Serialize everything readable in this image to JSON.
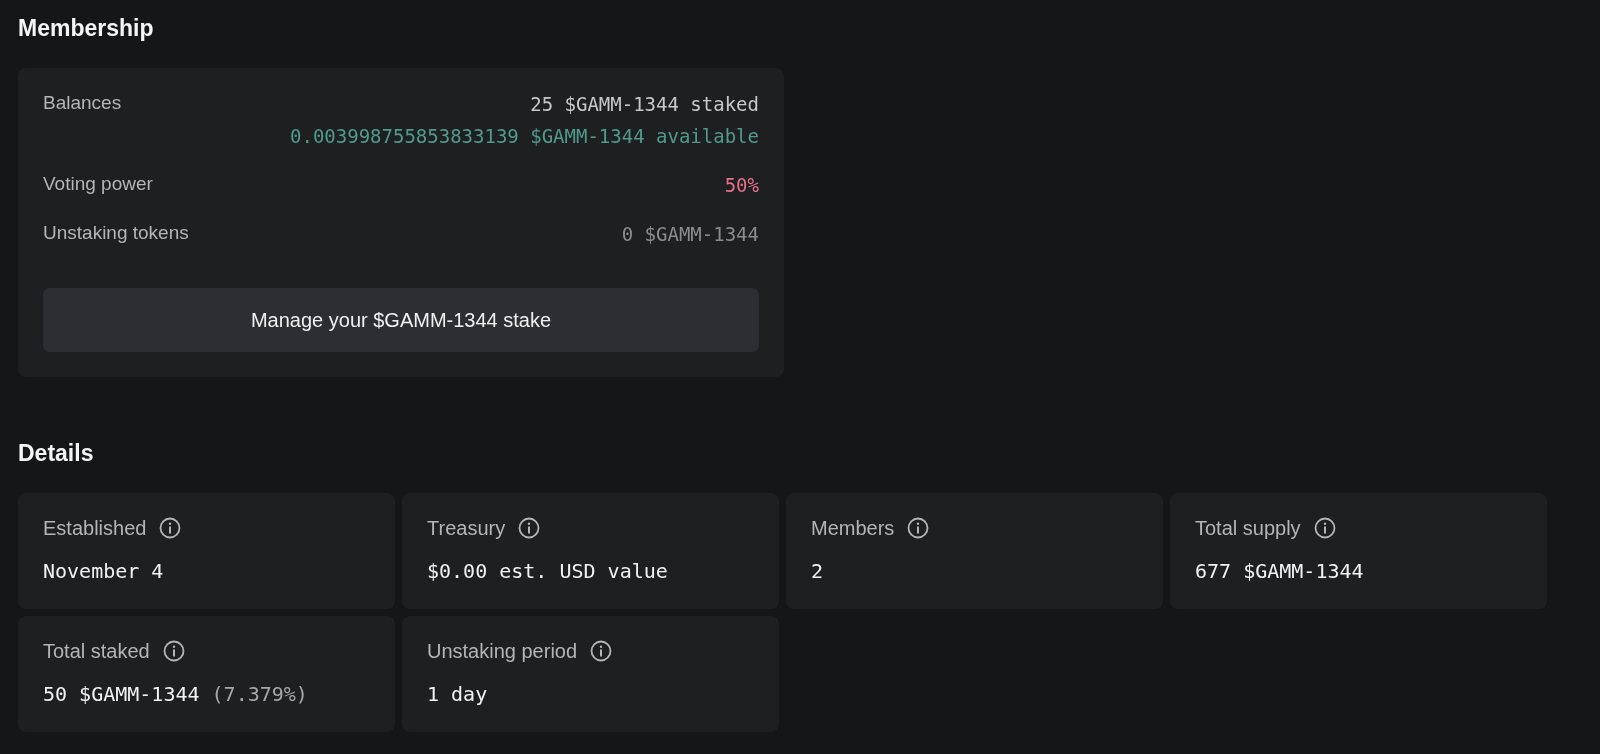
{
  "membership": {
    "title": "Membership",
    "rows": [
      {
        "label": "Balances",
        "values": [
          {
            "text": "25 $GAMM-1344 staked",
            "color": "#c8c8c8"
          },
          {
            "text": "0.003998755853833139 $GAMM-1344 available",
            "color": "#4f9a8a"
          }
        ]
      },
      {
        "label": "Voting power",
        "values": [
          {
            "text": "50%",
            "color": "#e8708c"
          }
        ]
      },
      {
        "label": "Unstaking tokens",
        "values": [
          {
            "text": "0 $GAMM-1344",
            "color": "#8c8c8c"
          }
        ]
      }
    ],
    "button": "Manage your $GAMM-1344 stake"
  },
  "details": {
    "title": "Details",
    "items": [
      {
        "label": "Established",
        "value": "November 4"
      },
      {
        "label": "Treasury",
        "value": "$0.00 est. USD value"
      },
      {
        "label": "Members",
        "value": "2"
      },
      {
        "label": "Total supply",
        "value": "677 $GAMM-1344"
      },
      {
        "label": "Total staked",
        "value": "50 $GAMM-1344",
        "note": "(7.379%)"
      },
      {
        "label": "Unstaking period",
        "value": "1 day"
      }
    ]
  }
}
